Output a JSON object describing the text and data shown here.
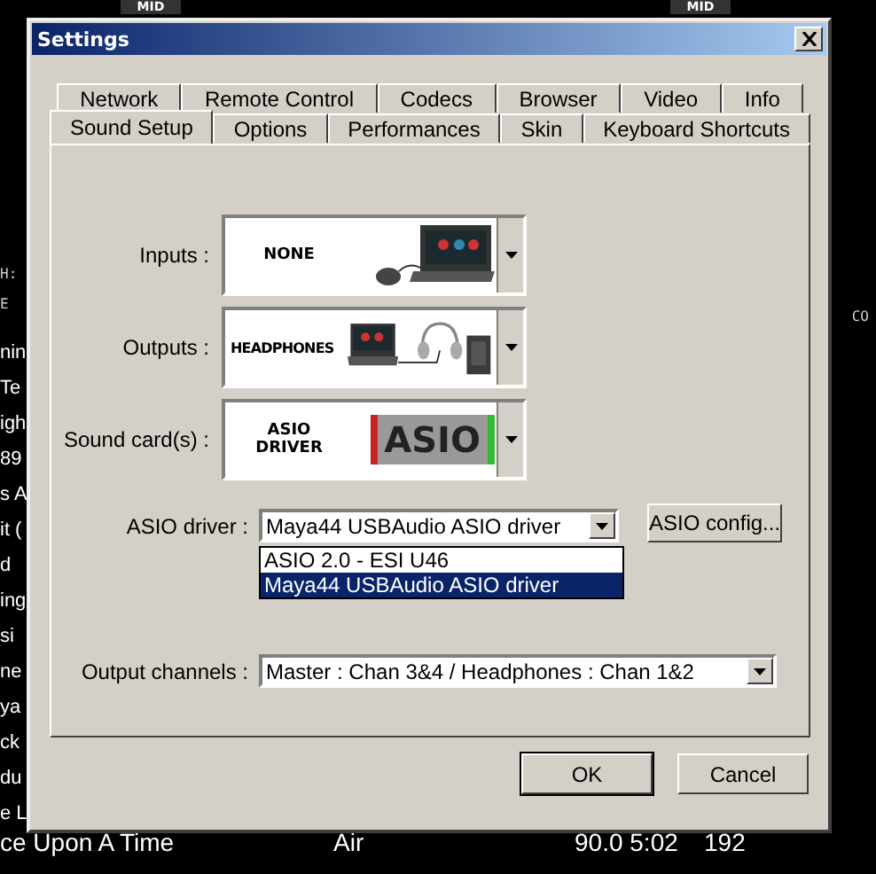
{
  "background": {
    "deck_labels": [
      "MID",
      "MID"
    ],
    "side_labels": [
      "H:",
      "E"
    ],
    "right_label": "CO",
    "left_fragments": [
      "nin",
      "Te",
      "igh",
      "89",
      "s A",
      "it (",
      "d",
      "ing",
      "si",
      "ne",
      "ya",
      "ck",
      "du",
      "e L"
    ],
    "track_row": {
      "title": "ce Upon A Time",
      "artist": "Air",
      "bpm_time": "90.0 5:02",
      "bitrate": "192"
    }
  },
  "window": {
    "title": "Settings"
  },
  "tabs_back": [
    {
      "label": "Network",
      "selected": false
    },
    {
      "label": "Remote Control",
      "selected": false
    },
    {
      "label": "Codecs",
      "selected": false
    },
    {
      "label": "Browser",
      "selected": false
    },
    {
      "label": "Video",
      "selected": false
    },
    {
      "label": "Info",
      "selected": false
    }
  ],
  "tabs_front": [
    {
      "label": "Sound Setup",
      "selected": true
    },
    {
      "label": "Options",
      "selected": false
    },
    {
      "label": "Performances",
      "selected": false
    },
    {
      "label": "Skin",
      "selected": false
    },
    {
      "label": "Keyboard Shortcuts",
      "selected": false
    }
  ],
  "devices": [
    {
      "label": "Inputs :",
      "name": "NONE",
      "kind": "input"
    },
    {
      "label": "Outputs :",
      "name": "HEADPHONES",
      "kind": "output"
    },
    {
      "label": "Sound card(s) :",
      "name": "ASIO DRIVER",
      "kind": "asio",
      "logo": "ASIO"
    }
  ],
  "asio_driver": {
    "label": "ASIO driver :",
    "value": "Maya44 USBAudio ASIO driver",
    "config_button": "ASIO config...",
    "options": [
      {
        "label": "ASIO 2.0 - ESI U46",
        "selected": false
      },
      {
        "label": "Maya44 USBAudio ASIO driver",
        "selected": true
      }
    ]
  },
  "output_channels": {
    "label": "Output channels :",
    "value": "Master : Chan 3&4 / Headphones : Chan 1&2"
  },
  "buttons": [
    {
      "label": "OK",
      "kind": "default"
    },
    {
      "label": "Cancel",
      "kind": "normal"
    }
  ]
}
